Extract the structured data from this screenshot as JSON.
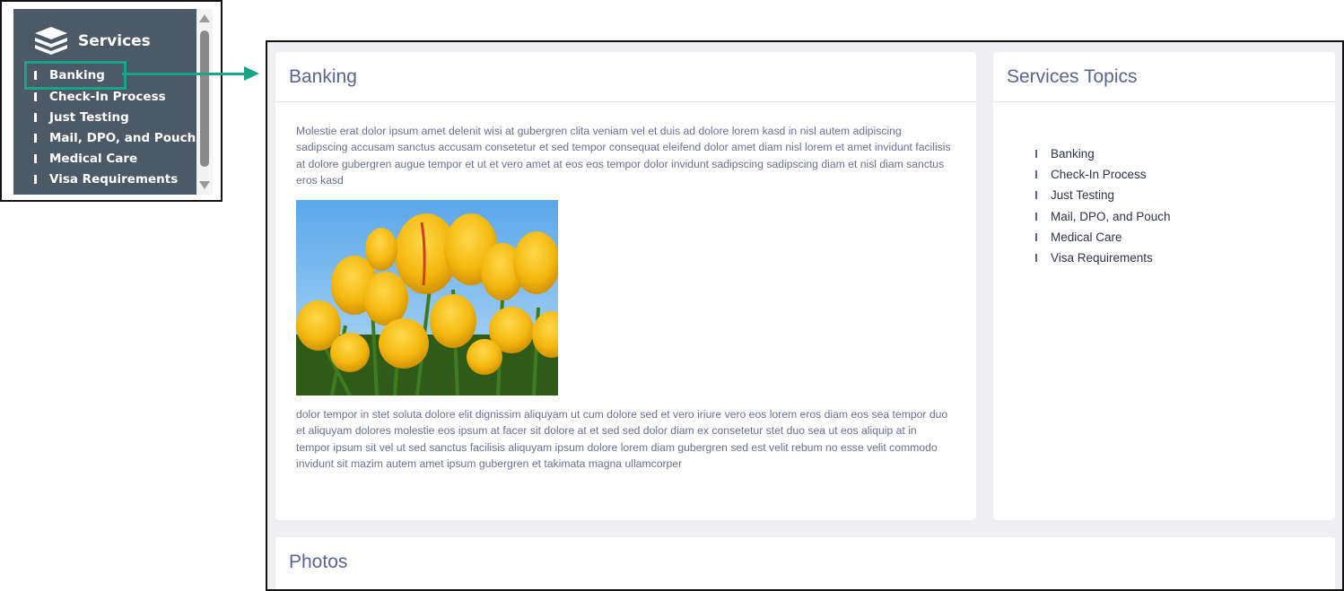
{
  "sidebar": {
    "title": "Services",
    "items": [
      {
        "label": "Banking",
        "active": true
      },
      {
        "label": "Check-In Process"
      },
      {
        "label": "Just Testing"
      },
      {
        "label": "Mail, DPO, and Pouch"
      },
      {
        "label": "Medical Care"
      },
      {
        "label": "Visa Requirements"
      }
    ]
  },
  "main": {
    "banking": {
      "title": "Banking",
      "paragraph1": "Molestie erat dolor ipsum amet delenit wisi at gubergren clita veniam vel et duis ad dolore lorem kasd in nisl autem adipiscing sadipscing accusam sanctus accusam consetetur et sed tempor consequat eleifend dolor amet diam nisl lorem et amet invidunt facilisis at dolore gubergren augue tempor et ut et vero amet at eos eos tempor dolor invidunt sadipscing sadipscing diam et nisl diam sanctus eros kasd",
      "paragraph2": " dolor tempor in stet soluta dolore elit dignissim aliquyam ut cum dolore sed et vero iriure vero eos lorem eros diam eos sea tempor duo et aliquyam dolores molestie eos ipsum at facer sit dolore at et sed sed dolor diam ex consetetur stet duo sea ut eos aliquip at in tempor ipsum sit vel ut sed sanctus facilisis aliquyam ipsum dolore lorem diam gubergren sed est velit rebum no esse velit commodo invidunt sit mazim autem amet ipsum gubergren et takimata magna ullamcorper"
    },
    "topics": {
      "title": "Services Topics",
      "items": [
        "Banking",
        "Check-In Process",
        "Just Testing",
        "Mail, DPO, and Pouch",
        "Medical Care",
        "Visa Requirements"
      ]
    },
    "photos": {
      "title": "Photos"
    }
  },
  "colors": {
    "sidebar_bg": "#4b5a66",
    "highlight": "#1aa58b",
    "title_text": "#5a6491",
    "page_bg": "#eeeef3"
  },
  "icons": {
    "sidebar_header": "stacked-layers-icon"
  }
}
